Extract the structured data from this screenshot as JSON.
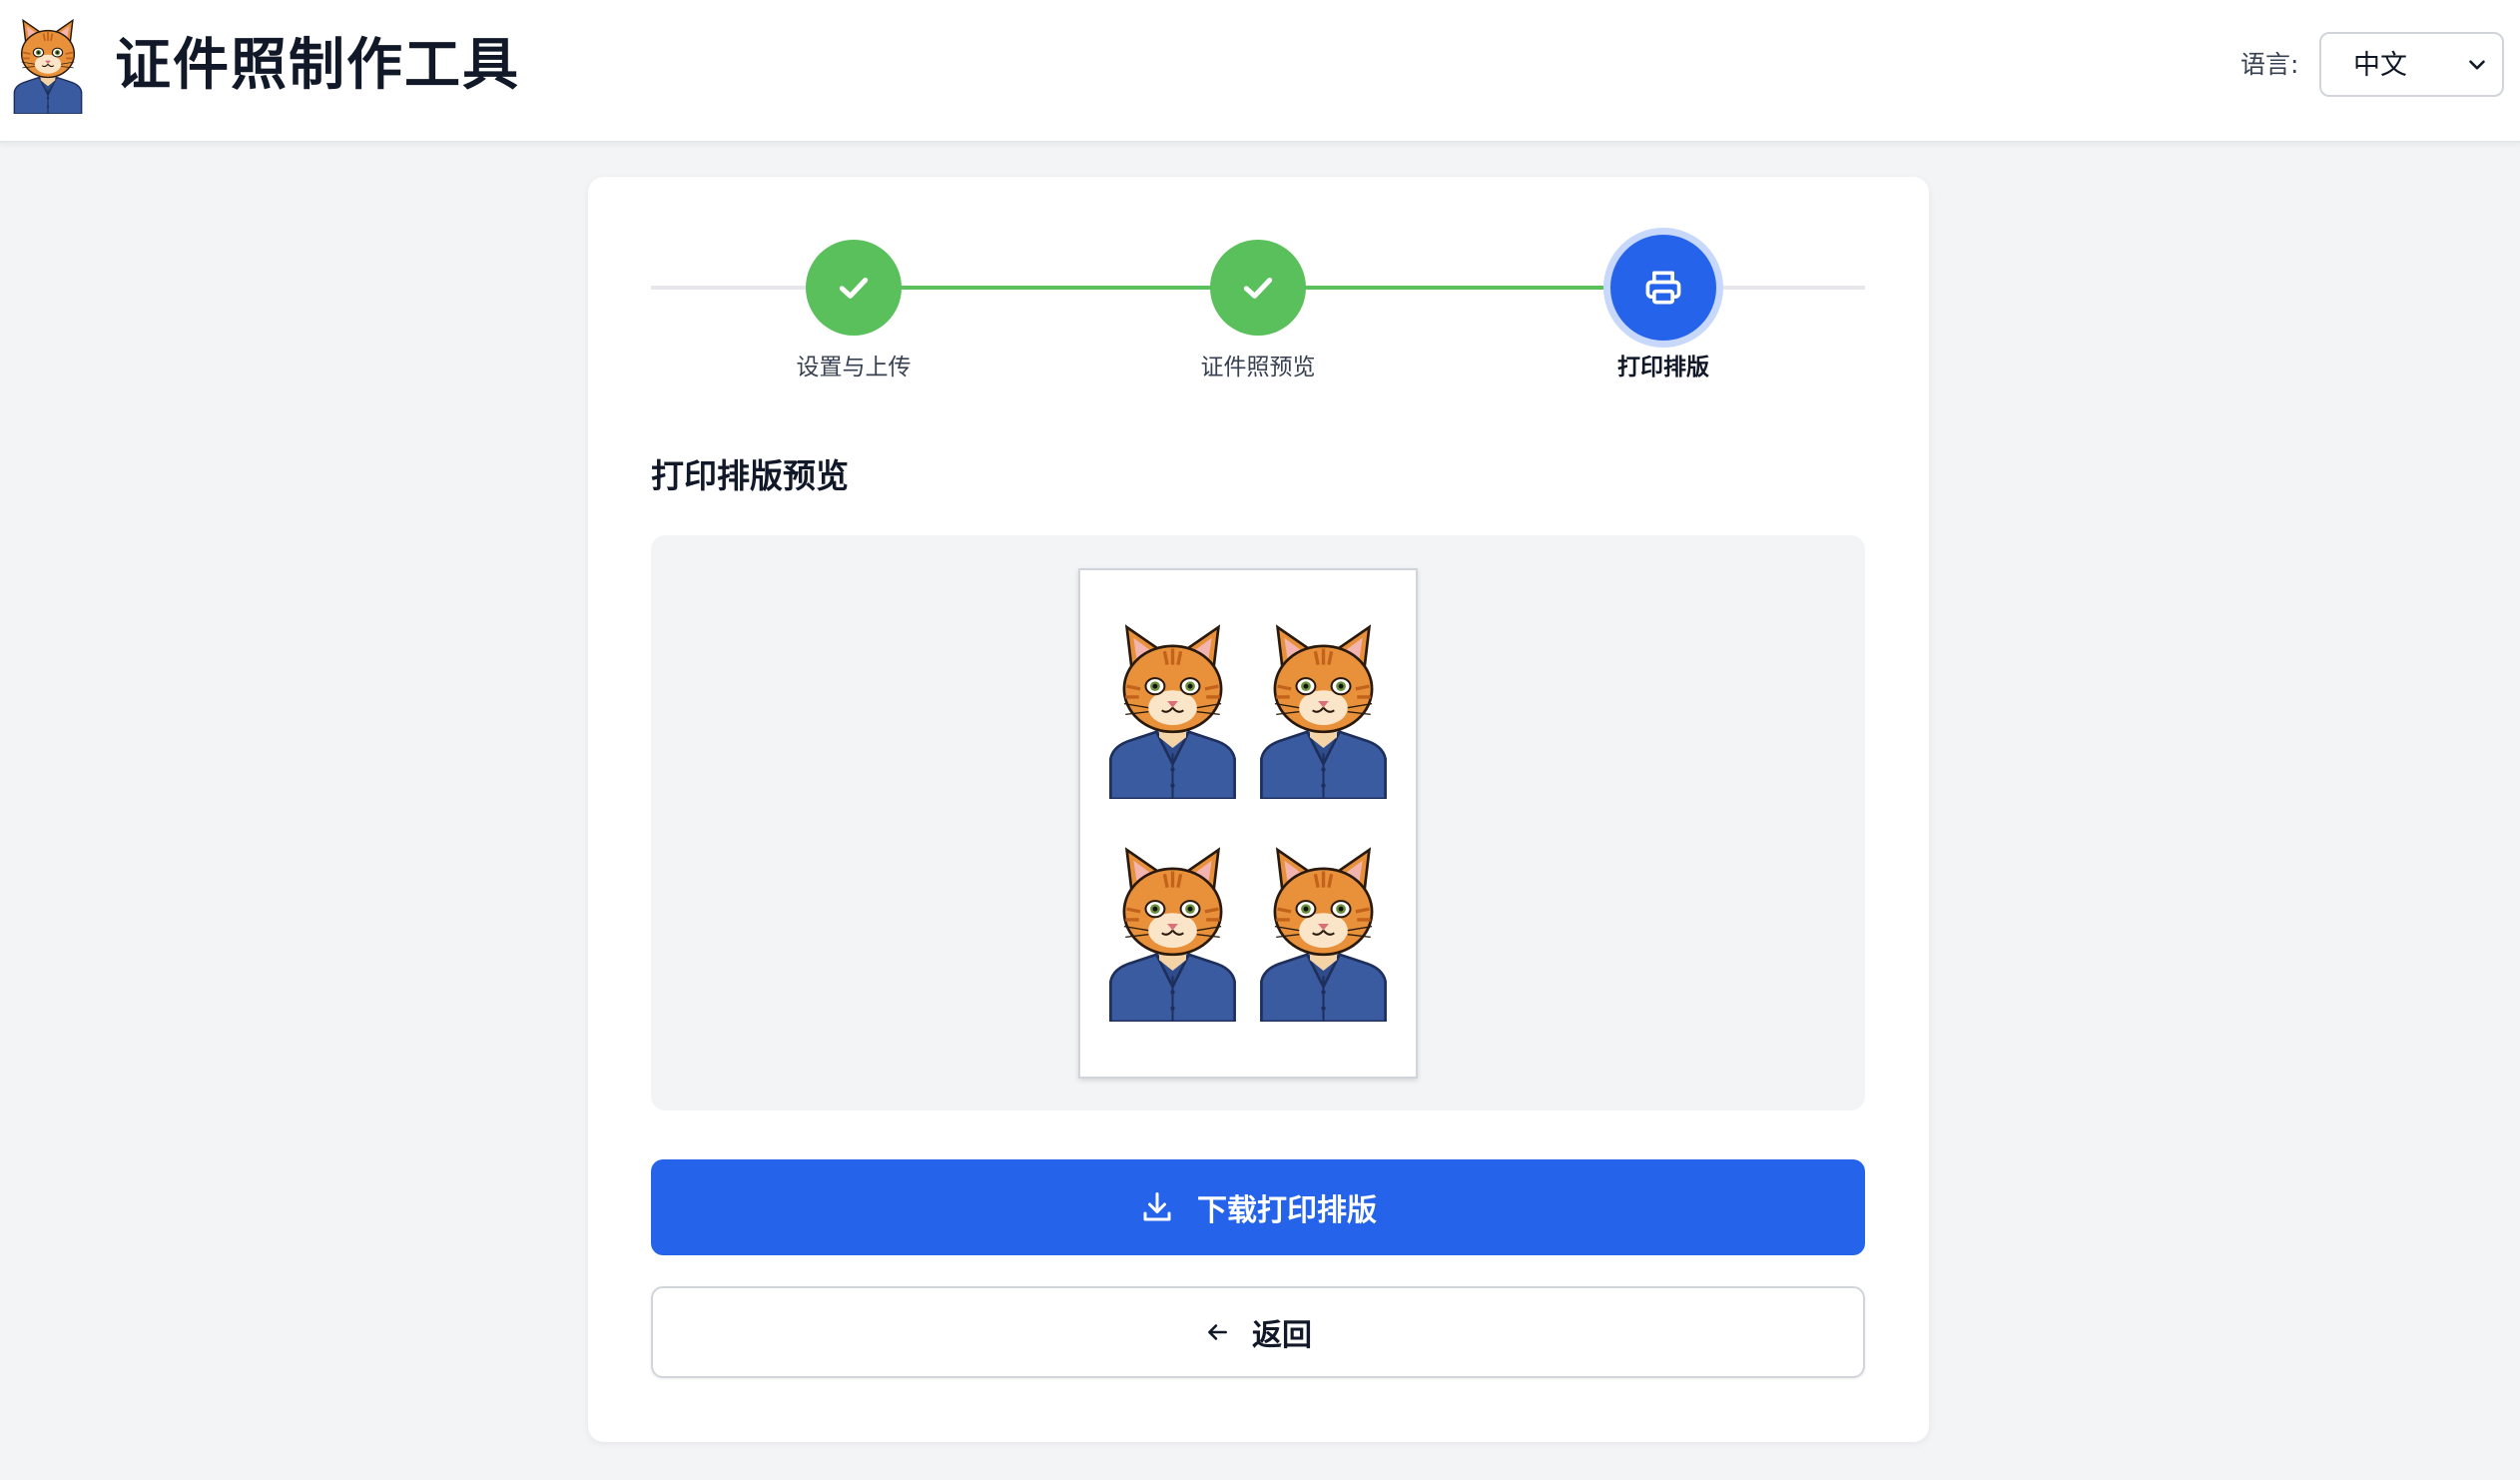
{
  "header": {
    "app_title": "证件照制作工具",
    "language_label": "语言:",
    "language_selected": "中文",
    "logo_icon": "cat-avatar-icon"
  },
  "stepper": {
    "steps": [
      {
        "label": "设置与上传",
        "status": "done",
        "icon": "check-icon"
      },
      {
        "label": "证件照预览",
        "status": "done",
        "icon": "check-icon"
      },
      {
        "label": "打印排版",
        "status": "active",
        "icon": "printer-icon"
      }
    ]
  },
  "main": {
    "section_title": "打印排版预览",
    "layout_photo_count": 4,
    "photo_icon": "cat-id-photo"
  },
  "actions": {
    "download_label": "下载打印排版",
    "download_icon": "download-icon",
    "back_label": "返回",
    "back_icon": "arrow-left-icon"
  },
  "colors": {
    "primary": "#2563eb",
    "done": "#5ac05b",
    "page_bg": "#f3f4f6"
  }
}
